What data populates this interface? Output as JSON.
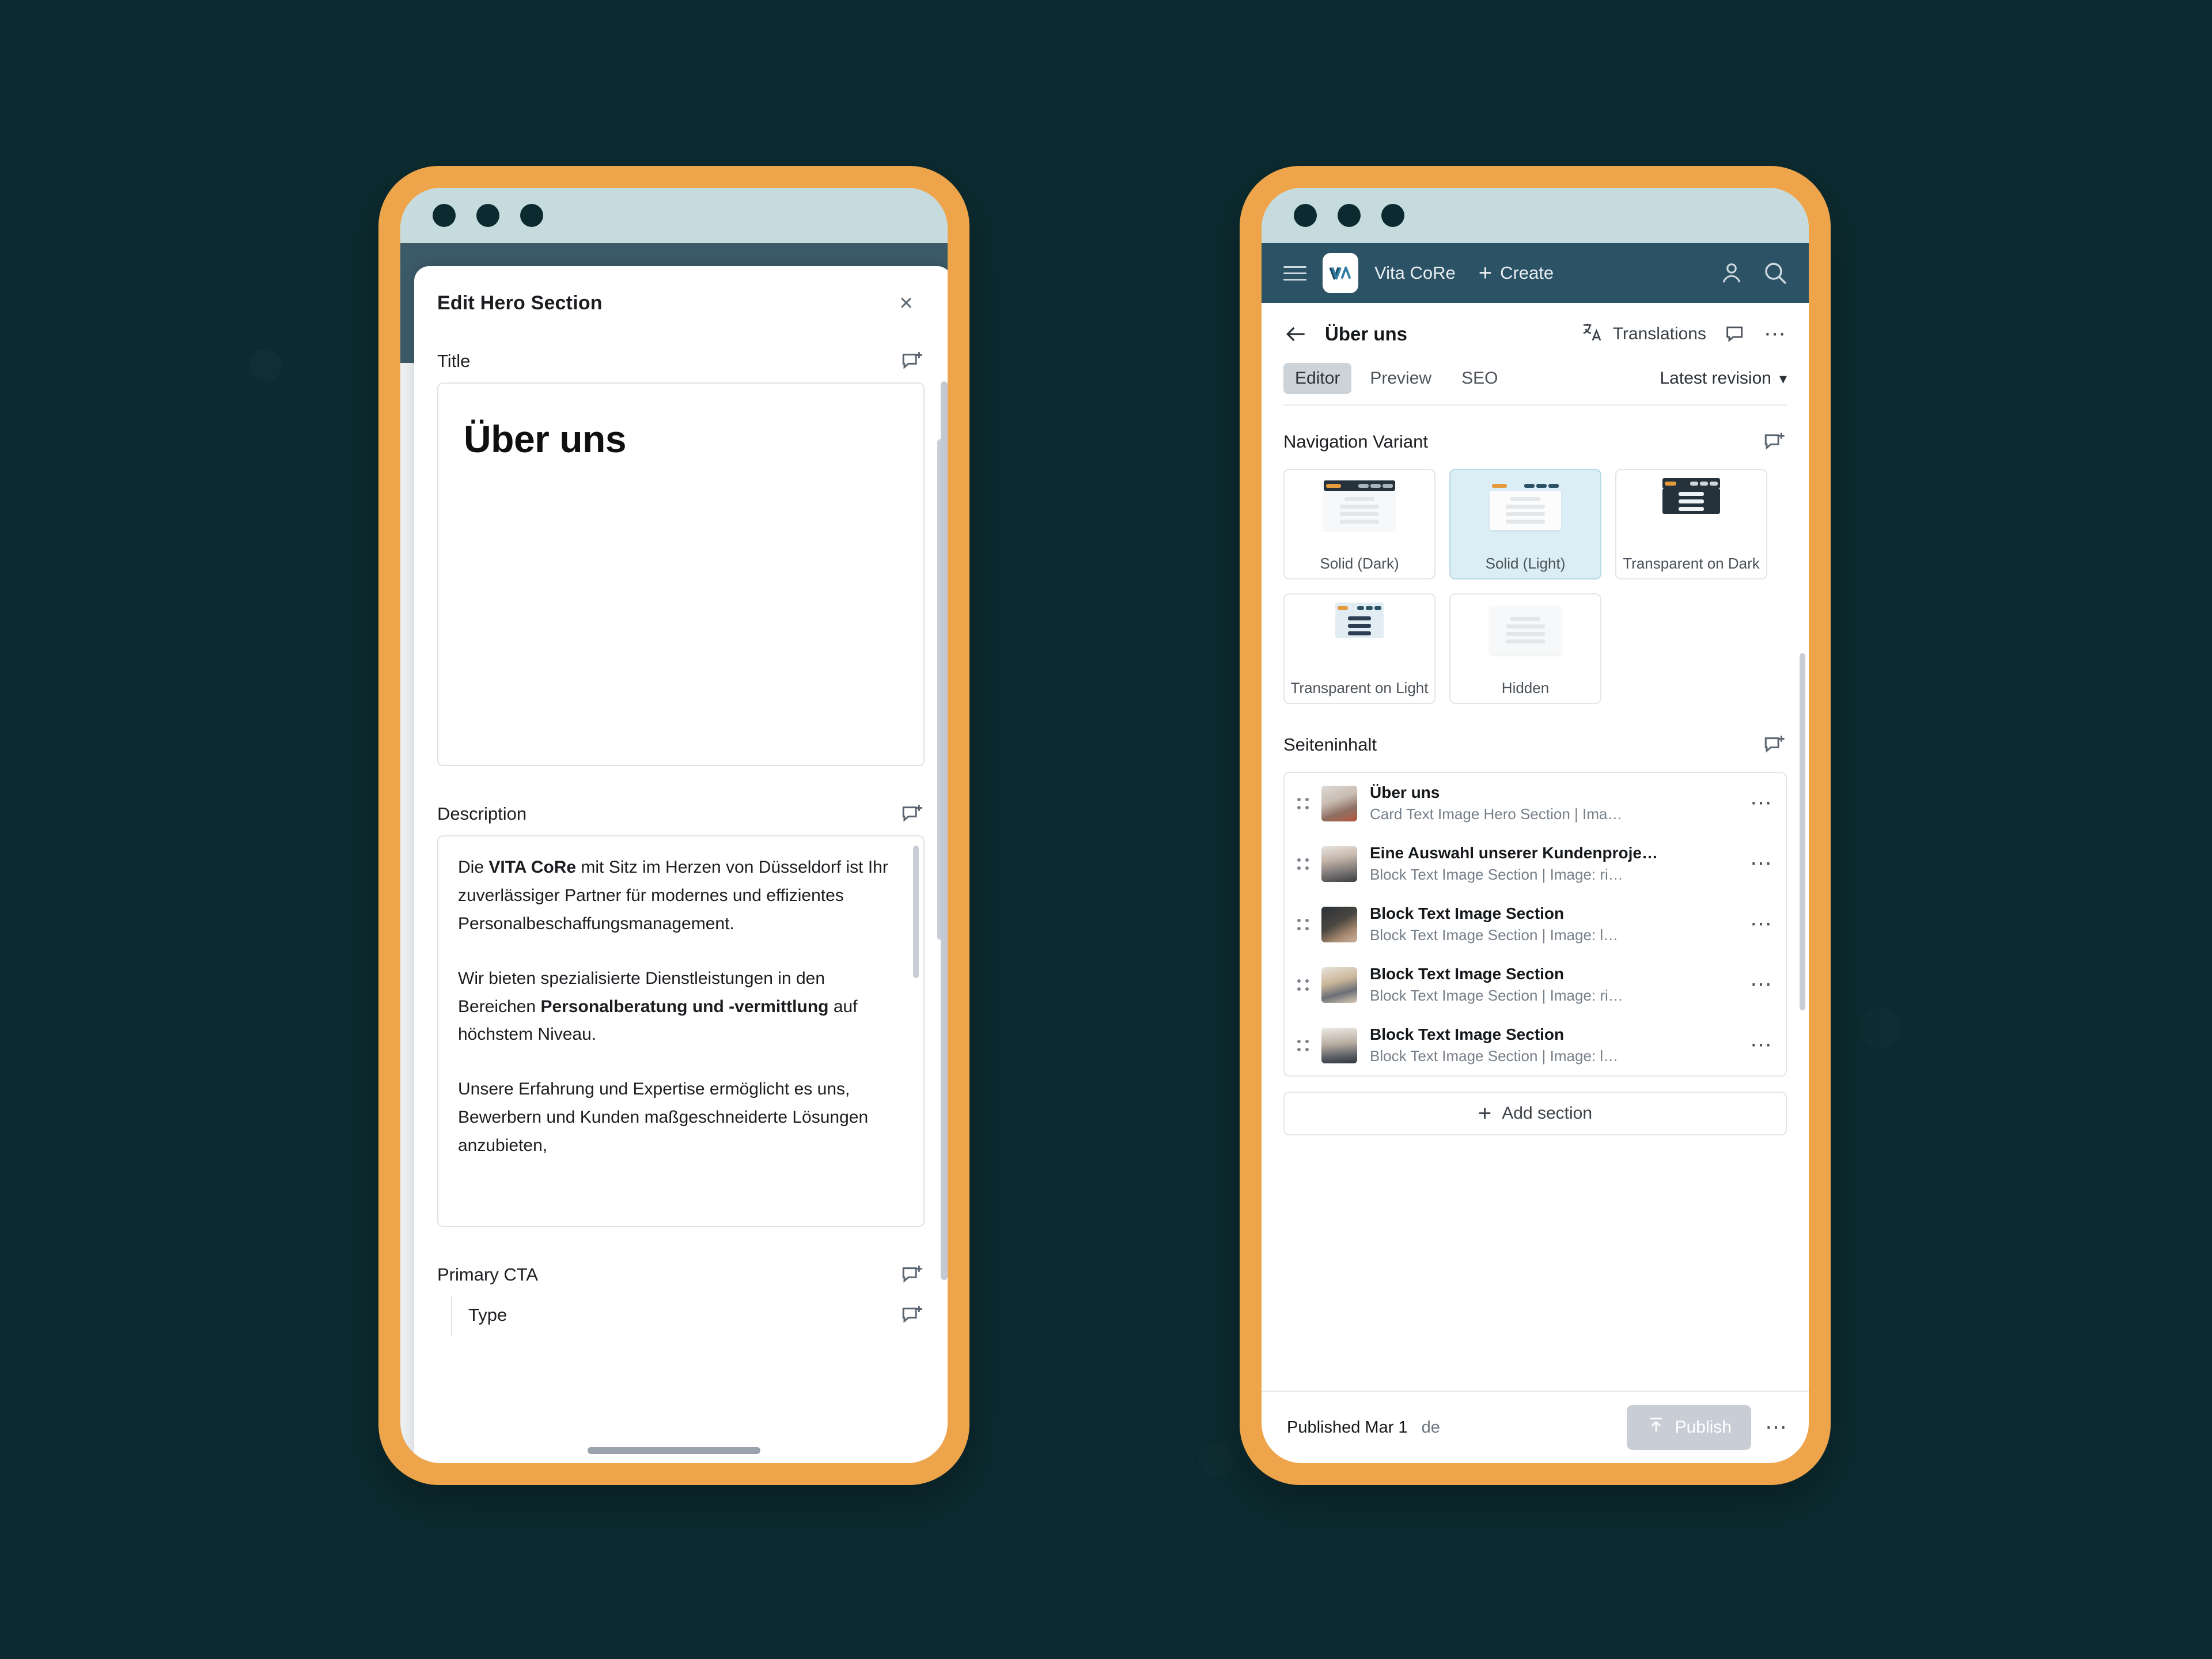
{
  "theme": {
    "background": "#0c2b30",
    "device_bezel": "#eda44a",
    "titlebar": "#c5dbdd",
    "appbar": "#2c5266",
    "accent_selected": "#dceef5"
  },
  "left_device": {
    "window_dots": [
      "dot",
      "dot",
      "dot"
    ],
    "modal": {
      "title": "Edit Hero Section",
      "close_label": "×",
      "fields": [
        {
          "label": "Title",
          "value": "Über uns"
        },
        {
          "label": "Description"
        },
        {
          "label": "Primary CTA"
        },
        {
          "label": "Type"
        }
      ],
      "description_paragraphs": [
        {
          "pre": "Die ",
          "bold": "VITA CoRe",
          "post": " mit Sitz im Herzen von Düsseldorf ist Ihr zuverlässiger Partner für modernes und effizientes Personalbeschaffungsmanagement."
        },
        {
          "pre": "Wir bieten spezialisierte Dienstleistungen in den Bereichen ",
          "bold": "Personalberatung und -vermittlung",
          "post": " auf höchstem Niveau."
        },
        {
          "pre": "Unsere Erfahrung und Expertise ermöglicht es uns, Bewerbern und Kunden maßgeschneiderte Lösungen anzubieten,",
          "bold": "",
          "post": ""
        }
      ]
    }
  },
  "right_device": {
    "appbar": {
      "menu_icon": "hamburger-icon",
      "logo_text": "VΛ",
      "brand": "Vita CoRe",
      "create_label": "Create",
      "account_icon": "account-icon",
      "search_icon": "search-icon"
    },
    "subheader": {
      "back_icon": "back-arrow-icon",
      "page_title": "Über uns",
      "translations_label": "Translations",
      "comment_icon": "comment-icon",
      "more_icon": "more-icon",
      "tabs": [
        {
          "label": "Editor",
          "active": true
        },
        {
          "label": "Preview",
          "active": false
        },
        {
          "label": "SEO",
          "active": false
        }
      ],
      "revision_label": "Latest revision"
    },
    "navigation_variant": {
      "section_title": "Navigation Variant",
      "comment_icon": "comment-add-icon",
      "options": [
        {
          "label": "Solid (Dark)",
          "selected": false,
          "style": "solid-dark"
        },
        {
          "label": "Solid (Light)",
          "selected": true,
          "style": "solid-light"
        },
        {
          "label": "Transparent on Dark",
          "selected": false,
          "style": "transparent-dark"
        },
        {
          "label": "Transparent on Light",
          "selected": false,
          "style": "transparent-light"
        },
        {
          "label": "Hidden",
          "selected": false,
          "style": "hidden"
        }
      ]
    },
    "seiteninhalt": {
      "section_title": "Seiteninhalt",
      "comment_icon": "comment-add-icon",
      "rows": [
        {
          "title": "Über uns",
          "subtitle": "Card Text Image Hero Section | Ima…",
          "thumb": "people-standing"
        },
        {
          "title": "Eine Auswahl unserer Kundenproje…",
          "subtitle": "Block Text Image Section | Image: ri…",
          "thumb": "office-interior"
        },
        {
          "title": "Block Text Image Section",
          "subtitle": "Block Text Image Section | Image: l…",
          "thumb": "desk-meeting"
        },
        {
          "title": "Block Text Image Section",
          "subtitle": "Block Text Image Section | Image: ri…",
          "thumb": "team-table"
        },
        {
          "title": "Block Text Image Section",
          "subtitle": "Block Text Image Section | Image: l…",
          "thumb": "conference-room"
        }
      ],
      "add_section_label": "Add section"
    },
    "footer": {
      "status": "Published Mar 1",
      "language": "de",
      "publish_label": "Publish",
      "publish_icon": "publish-upload-icon",
      "more_icon": "more-icon"
    }
  }
}
